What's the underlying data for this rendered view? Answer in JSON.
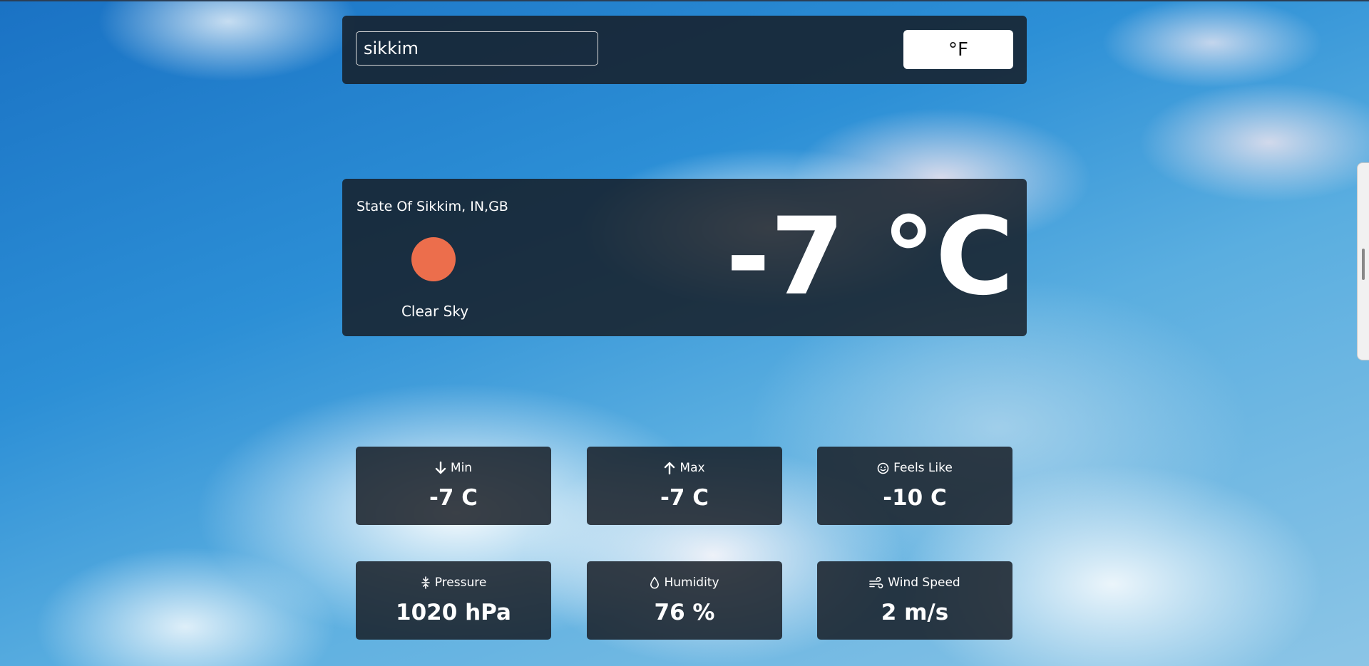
{
  "search": {
    "value": "sikkim",
    "unit_toggle_label": "°F"
  },
  "current": {
    "location": "State Of Sikkim, IN,GB",
    "description": "Clear Sky",
    "temperature": "-7 °C",
    "icon": "sun-icon",
    "icon_color": "#ec6e4c"
  },
  "stats": [
    {
      "label": "Min",
      "value": "-7 C",
      "icon": "arrow-down-icon"
    },
    {
      "label": "Max",
      "value": "-7 C",
      "icon": "arrow-up-icon"
    },
    {
      "label": "Feels Like",
      "value": "-10 C",
      "icon": "smile-icon"
    },
    {
      "label": "Pressure",
      "value": "1020 hPa",
      "icon": "compress-icon"
    },
    {
      "label": "Humidity",
      "value": "76 %",
      "icon": "droplet-icon"
    },
    {
      "label": "Wind Speed",
      "value": "2 m/s",
      "icon": "wind-icon"
    }
  ]
}
